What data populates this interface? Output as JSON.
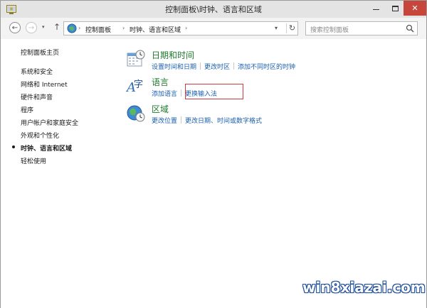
{
  "window": {
    "title": "控制面板\\时钟、语言和区域"
  },
  "navbar": {
    "back_glyph": "←",
    "forward_glyph": "→",
    "up_glyph": "↑",
    "dropdown_glyph": "▾",
    "breadcrumb": [
      "控制面板",
      "时钟、语言和区域"
    ],
    "separator_glyph": "›",
    "refresh_glyph": "↻",
    "search_placeholder": "搜索控制面板"
  },
  "sidebar": {
    "items": [
      {
        "label": "控制面板主页",
        "active": false
      },
      {
        "label": "系统和安全",
        "active": false
      },
      {
        "label": "网络和 Internet",
        "active": false
      },
      {
        "label": "硬件和声音",
        "active": false
      },
      {
        "label": "程序",
        "active": false
      },
      {
        "label": "用户帐户和家庭安全",
        "active": false
      },
      {
        "label": "外观和个性化",
        "active": false
      },
      {
        "label": "时钟、语言和区域",
        "active": true
      },
      {
        "label": "轻松使用",
        "active": false
      }
    ]
  },
  "categories": [
    {
      "title": "日期和时间",
      "icon": "calendar-clock-icon",
      "links": [
        "设置时间和日期",
        "更改时区",
        "添加不同时区的时钟"
      ]
    },
    {
      "title": "语言",
      "icon": "language-icon",
      "links": [
        "添加语言",
        "更换输入法"
      ]
    },
    {
      "title": "区域",
      "icon": "globe-clock-icon",
      "links": [
        "更改位置",
        "更改日期、时间或数字格式"
      ]
    }
  ],
  "highlighted_link": "更换输入法",
  "watermark": "win8xiazai.com",
  "colors": {
    "category_title": "#1e7a2e",
    "link": "#1a5fae",
    "close_button": "#c7463b",
    "highlight_box": "#d03a3a"
  }
}
